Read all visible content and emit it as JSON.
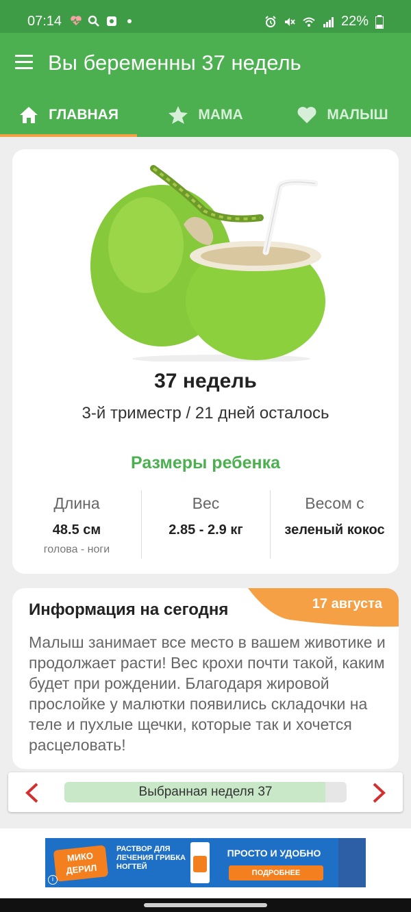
{
  "status_bar": {
    "time": "07:14",
    "battery": "22%"
  },
  "app_bar": {
    "title": "Вы беременны 37 недель"
  },
  "tabs": [
    {
      "label": "ГЛАВНАЯ",
      "icon": "home-icon",
      "active": true
    },
    {
      "label": "МАМА",
      "icon": "star-icon",
      "active": false
    },
    {
      "label": "МАЛЫШ",
      "icon": "heart-icon",
      "active": false
    }
  ],
  "main_card": {
    "image": "green-coconut-image",
    "week_title": "37 недель",
    "week_subtitle": "3-й триместр / 21 дней осталось",
    "sizes_title": "Размеры ребенка",
    "stats": [
      {
        "label": "Длина",
        "value": "48.5 см",
        "note": "голова - ноги"
      },
      {
        "label": "Вес",
        "value": "2.85 - 2.9 кг",
        "note": ""
      },
      {
        "label": "Весом с",
        "value": "зеленый кокос",
        "note": ""
      }
    ]
  },
  "info_card": {
    "title": "Информация на сегодня",
    "date": "17 августа",
    "text": "Малыш занимает все место в вашем животике и продолжает расти! Вес крохи почти такой, каким будет при рождении. Благодаря жировой прослойке у малютки появились складочки на теле и пухлые щечки, которые так и хочется расцеловать!"
  },
  "week_nav": {
    "label": "Выбранная неделя 37",
    "progress": 0.925
  },
  "ad": {
    "logo": "МИКО ДЕРИЛ",
    "text": "РАСТВОР ДЛЯ ЛЕЧЕНИЯ ГРИБКА НОГТЕЙ",
    "headline": "ПРОСТО И УДОБНО",
    "cta": "ПОДРОБНЕЕ"
  },
  "colors": {
    "primary": "#4cb050",
    "status_bar": "#3f9c46",
    "accent": "#f5a044",
    "arrow": "#d32f2f"
  }
}
